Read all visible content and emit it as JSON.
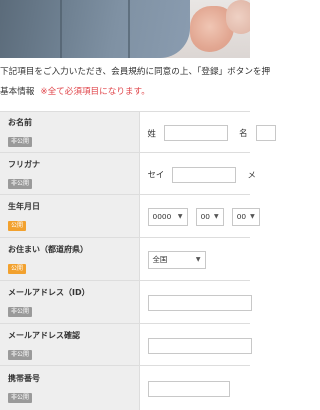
{
  "intro_text": "下記項目をご入力いただき、会員規約に同意の上、「登録」ボタンを押",
  "section_title": "基本情報",
  "required_note": "※全て必須項目になります。",
  "badges": {
    "private": "非公開",
    "public": "公開"
  },
  "fields": {
    "name": {
      "label": "お名前",
      "badge": "非公開",
      "sei": "姓",
      "mei": "名"
    },
    "kana": {
      "label": "フリガナ",
      "badge": "非公開",
      "sei": "セイ",
      "mei": "メ"
    },
    "birth": {
      "label": "生年月日",
      "badge": "公開",
      "year": "0000",
      "month": "00",
      "day": "00"
    },
    "address": {
      "label": "お住まい（都道府県）",
      "badge": "公開",
      "value": "全国"
    },
    "email": {
      "label": "メールアドレス（ID）",
      "badge": "非公開"
    },
    "email_confirm": {
      "label": "メールアドレス確認",
      "badge": "非公開"
    },
    "phone": {
      "label": "携帯番号",
      "badge": "非公開"
    }
  }
}
